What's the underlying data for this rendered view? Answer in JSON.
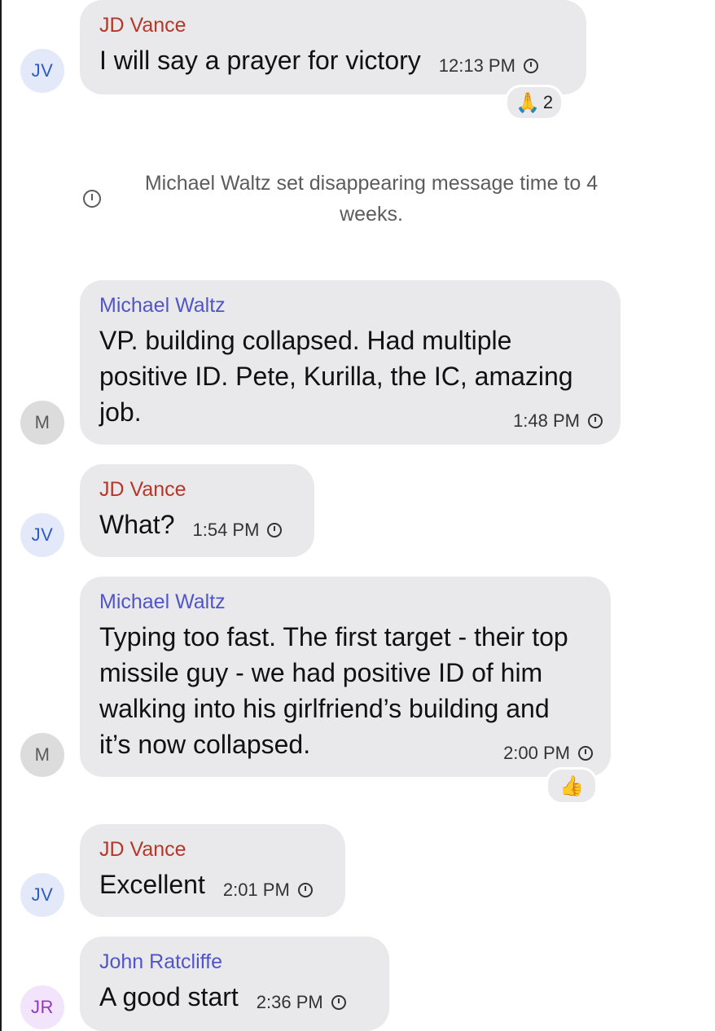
{
  "messages": [
    {
      "sender": "JD Vance",
      "avatar": "JV",
      "text": "I will say a prayer for victory",
      "time": "12:13 PM",
      "reaction": {
        "emoji": "🙏",
        "count": "2"
      }
    },
    {
      "system": "Michael Waltz set disappearing message time to 4 weeks."
    },
    {
      "sender": "Michael Waltz",
      "avatar": "M",
      "text": "VP.  building collapsed. Had multiple positive ID. Pete, Kurilla, the IC, amazing job.",
      "time": "1:48 PM"
    },
    {
      "sender": "JD Vance",
      "avatar": "JV",
      "text": "What?",
      "time": "1:54 PM"
    },
    {
      "sender": "Michael Waltz",
      "avatar": "M",
      "text": "Typing too fast. The first target - their top missile guy - we had positive ID of him walking into his girlfriend’s building and it’s now collapsed.",
      "time": "2:00 PM",
      "reaction": {
        "emoji": "👍"
      }
    },
    {
      "sender": "JD Vance",
      "avatar": "JV",
      "text": "Excellent",
      "time": "2:01 PM"
    },
    {
      "sender": "John Ratcliffe",
      "avatar": "JR",
      "text": "A good start",
      "time": "2:36 PM"
    }
  ],
  "colors": {
    "bubble": "#e9e9eb",
    "sender_red": "#b3382b",
    "sender_blue": "#5155c9",
    "avatar_jv_bg": "#e4e9fa",
    "avatar_m_bg": "#dcdcdc",
    "avatar_jr_bg": "#f2e5fb"
  },
  "icons": {
    "timer": "disappearing-timer-icon",
    "pray": "folded-hands-emoji",
    "thumbs": "thumbs-up-emoji"
  }
}
